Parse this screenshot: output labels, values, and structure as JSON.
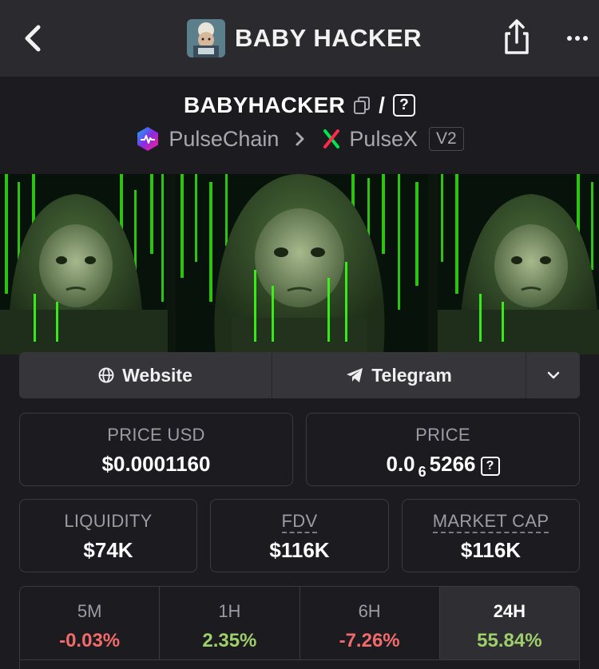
{
  "nav": {
    "title": "BABY HACKER",
    "icons": {
      "back": "chevron-left-icon",
      "share": "share-icon",
      "more": "more-dots-icon"
    }
  },
  "pair": {
    "symbol": "BABYHACKER",
    "slash": "/",
    "quote_unknown": "?",
    "chain": "PulseChain",
    "dex": "PulseX",
    "version": "V2"
  },
  "links": {
    "website": "Website",
    "telegram": "Telegram"
  },
  "stats": {
    "price_usd_label": "PRICE USD",
    "price_usd_value": "$0.0001160",
    "price_label": "PRICE",
    "price_value_prefix": "0.0",
    "price_value_zeros": "6",
    "price_value_digits": "5266",
    "price_quote_unknown": "?",
    "liquidity_label": "LIQUIDITY",
    "liquidity_value": "$74K",
    "fdv_label": "FDV",
    "fdv_value": "$116K",
    "mcap_label": "MARKET CAP",
    "mcap_value": "$116K"
  },
  "timeframes": [
    {
      "label": "5M",
      "change": "-0.03%",
      "color": "#f26b6b"
    },
    {
      "label": "1H",
      "change": "2.35%",
      "color": "#9fcf6a"
    },
    {
      "label": "6H",
      "change": "-7.26%",
      "color": "#f26b6b"
    },
    {
      "label": "24H",
      "change": "55.84%",
      "color": "#9fcf6a",
      "active": true
    }
  ],
  "colors": {
    "background": "#1b1b20",
    "nav": "#2b2b2f",
    "negative": "#f26b6b",
    "positive": "#9fcf6a",
    "banner_green": "#39ff14"
  }
}
